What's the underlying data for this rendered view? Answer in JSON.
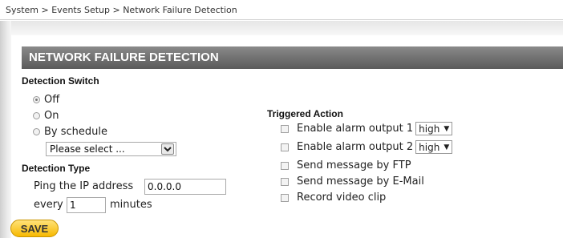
{
  "breadcrumb": "System > Events Setup > Network Failure Detection",
  "section_title": "NETWORK FAILURE DETECTION",
  "detection_switch": {
    "label": "Detection Switch",
    "options": [
      {
        "label": "Off",
        "checked": true
      },
      {
        "label": "On",
        "checked": false
      },
      {
        "label": "By schedule",
        "checked": false
      }
    ],
    "schedule_select": "Please select ..."
  },
  "detection_type": {
    "label": "Detection Type",
    "ping_label": "Ping the IP address",
    "ip_value": "0.0.0.0",
    "every_label": "every",
    "every_value": "1",
    "minutes_label": "minutes"
  },
  "triggered_action": {
    "label": "Triggered Action",
    "items": [
      {
        "label": "Enable alarm output 1",
        "select": "high"
      },
      {
        "label": "Enable alarm output 2",
        "select": "high"
      },
      {
        "label": "Send message by FTP"
      },
      {
        "label": "Send message by E-Mail"
      },
      {
        "label": "Record video clip"
      }
    ]
  },
  "save_label": "SAVE"
}
